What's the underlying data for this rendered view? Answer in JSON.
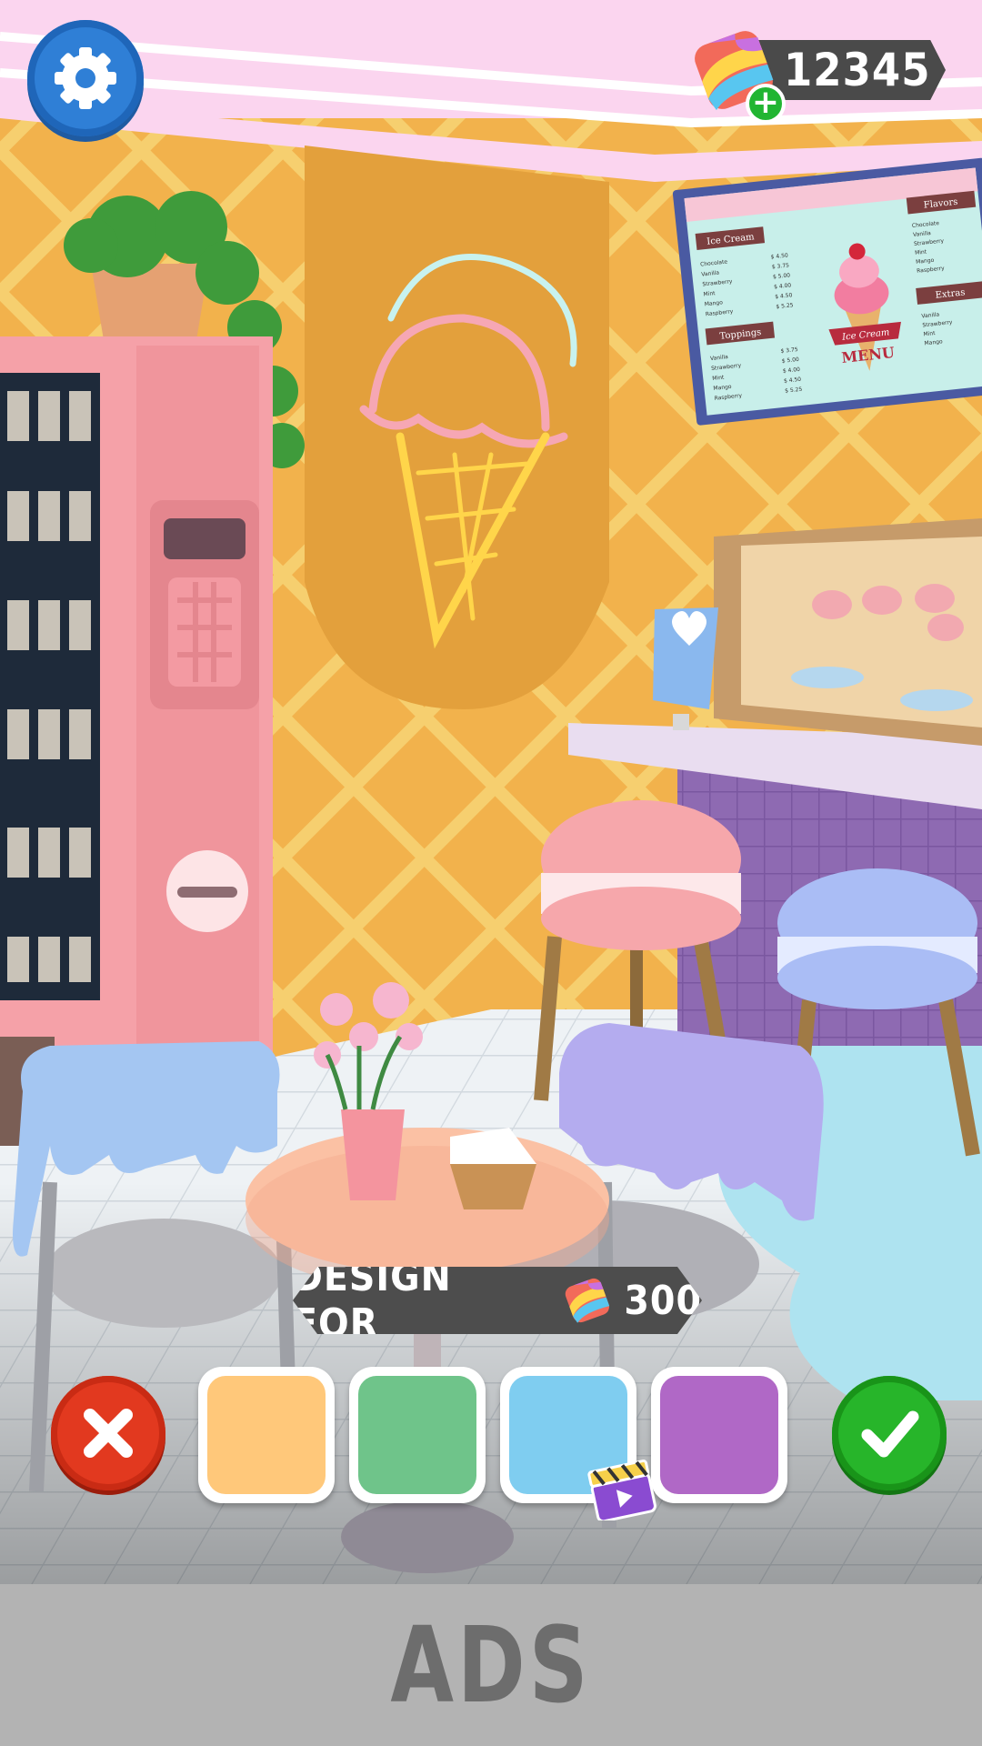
{
  "scene": {
    "description_icon": "ice-cream-shop-scene",
    "menu_board": {
      "left_title": "Ice Cream",
      "left_items": [
        "Chocolate",
        "Vanilla",
        "Strawberry",
        "Mint",
        "Mango",
        "Raspberry"
      ],
      "left_prices": [
        "$ 4.50",
        "$ 3.75",
        "$ 5.00",
        "$ 4.00",
        "$ 4.50",
        "$ 5.25"
      ],
      "toppings_title": "Toppings",
      "toppings_items": [
        "Vanilla",
        "Strawberry",
        "Mint",
        "Mango",
        "Raspberry"
      ],
      "toppings_prices": [
        "$ 3.75",
        "$ 5.00",
        "$ 4.00",
        "$ 4.50",
        "$ 5.25"
      ],
      "flavors_title": "Flavors",
      "flavors_items": [
        "Chocolate",
        "Vanilla",
        "Strawberry",
        "Mint",
        "Mango",
        "Raspberry"
      ],
      "extras_title": "Extras",
      "extras_items": [
        "Vanilla",
        "Strawberry",
        "Mint",
        "Mango"
      ],
      "logo_line1": "Ice Cream",
      "logo_line2": "MENU"
    }
  },
  "hud": {
    "settings_icon": "gear-icon",
    "currency_value": "12345",
    "currency_icon": "rainbow-gem-icon",
    "add_currency_symbol": "+"
  },
  "design": {
    "label": "DESIGN FOR",
    "cost": "300"
  },
  "swatches": [
    {
      "name": "orange",
      "color": "#ffc87a"
    },
    {
      "name": "green",
      "color": "#6fc48a"
    },
    {
      "name": "blue",
      "color": "#7fcdf0",
      "ad_icon": "video-ad-icon"
    },
    {
      "name": "purple",
      "color": "#b068c6"
    }
  ],
  "buttons": {
    "cancel_icon": "close-icon",
    "confirm_icon": "check-icon"
  },
  "ads": {
    "label": "ADS"
  }
}
